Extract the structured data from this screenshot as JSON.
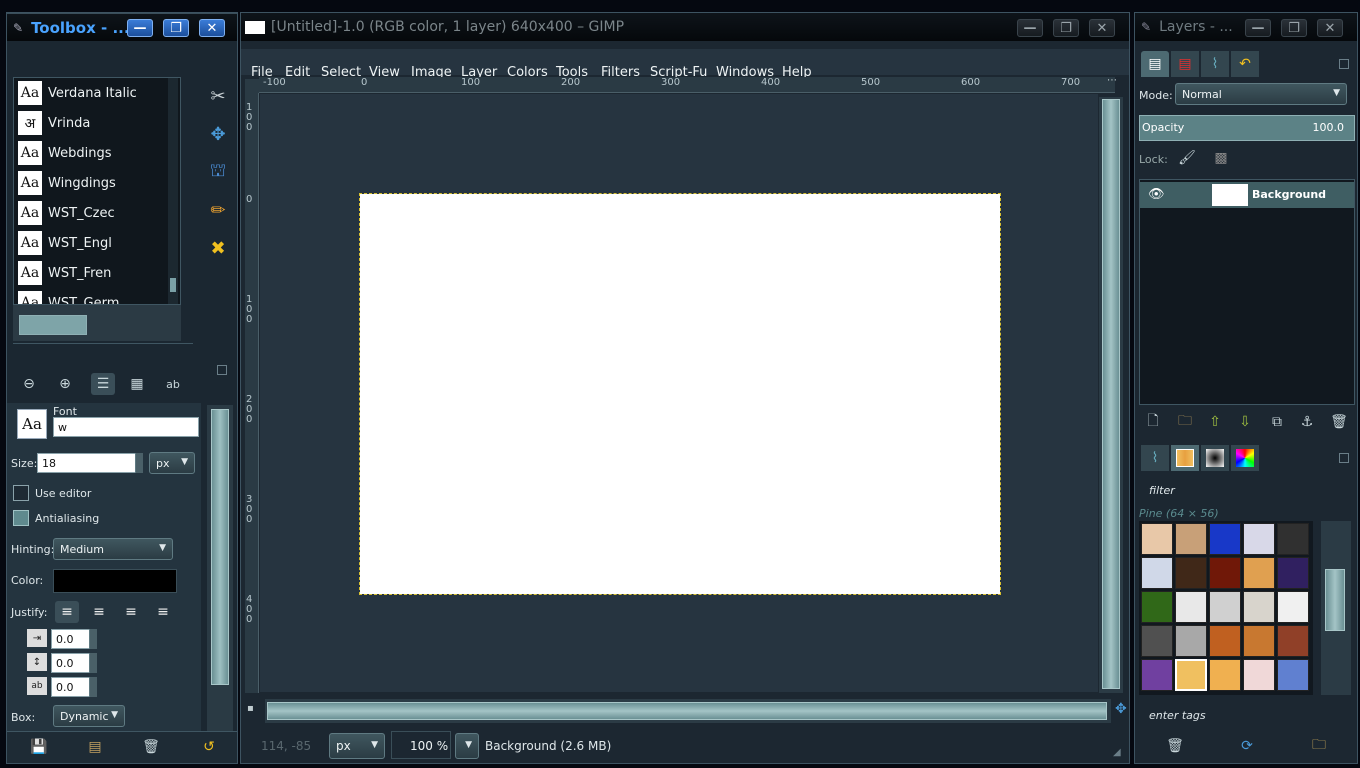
{
  "toolbox": {
    "title": "Toolbox - ...",
    "fonts": [
      {
        "icon": "Aa",
        "name": "Verdana Italic"
      },
      {
        "icon": "अ",
        "name": "Vrinda"
      },
      {
        "icon": "Aa",
        "name": "Webdings"
      },
      {
        "icon": "Aa",
        "name": "Wingdings"
      },
      {
        "icon": "Aa",
        "name": "WST_Czec"
      },
      {
        "icon": "Aa",
        "name": "WST_Engl"
      },
      {
        "icon": "Aa",
        "name": "WST_Fren"
      },
      {
        "icon": "Aa",
        "name": "WST_Germ"
      }
    ],
    "tool_options": {
      "font_label": "Font",
      "font_icon": "Aa",
      "font_value": "w",
      "size_label": "Size:",
      "size_value": "18",
      "size_unit": "px",
      "use_editor": "Use editor",
      "antialiasing": "Antialiasing",
      "hinting_label": "Hinting:",
      "hinting_value": "Medium",
      "color_label": "Color:",
      "color_value": "#000000",
      "justify_label": "Justify:",
      "indent_value": "0.0",
      "line_spacing_value": "0.0",
      "letter_spacing_value": "0.0",
      "box_label": "Box:",
      "box_value": "Dynamic"
    }
  },
  "image_window": {
    "title": "[Untitled]-1.0 (RGB color, 1 layer) 640x400 – GIMP",
    "menu": [
      "File",
      "Edit",
      "Select",
      "View",
      "Image",
      "Layer",
      "Colors",
      "Tools",
      "Filters",
      "Script-Fu",
      "Windows",
      "Help"
    ],
    "ruler_h": [
      "-100",
      "0",
      "100",
      "200",
      "300",
      "400",
      "500",
      "600",
      "700"
    ],
    "ruler_v": [
      "100",
      "0",
      "100",
      "200",
      "300",
      "400"
    ],
    "status": {
      "coords": "114, -85",
      "unit": "px",
      "zoom": "100 %",
      "layer_info": "Background (2.6 MB)"
    }
  },
  "layers": {
    "title": "Layers - ...",
    "mode_label": "Mode:",
    "mode_value": "Normal",
    "opacity_label": "Opacity",
    "opacity_value": "100.0",
    "lock_label": "Lock:",
    "layer_name": "Background",
    "patterns_filter": "filter",
    "pattern_name": "Pine (64 × 56)",
    "tags_placeholder": "enter tags"
  },
  "colors": {
    "accent": "#3a7cd8",
    "panel": "#243440",
    "canvas_bg": "#263440"
  }
}
